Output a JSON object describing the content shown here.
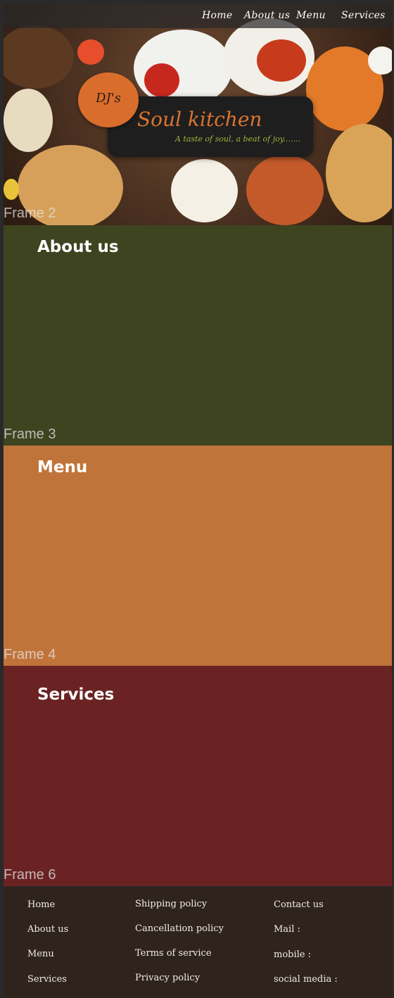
{
  "nav": {
    "items": [
      "Home",
      "About us",
      "Menu",
      "Services"
    ]
  },
  "brand": {
    "logo": "DJ's",
    "title": "Soul kitchen",
    "tagline": "A taste of soul, a beat of joy......."
  },
  "frames": {
    "hero_next_label": "Frame 2",
    "about_label": "Frame 3",
    "menu_label": "Frame 4",
    "services_label": "Frame 6"
  },
  "sections": {
    "about": {
      "title": "About us",
      "color": "#3e4420"
    },
    "menu": {
      "title": "Menu",
      "color": "#c0743a"
    },
    "services": {
      "title": "Services",
      "color": "#6a2222"
    }
  },
  "footer": {
    "col1": [
      "Home",
      "About us",
      "Menu",
      "Services"
    ],
    "col2": [
      "Shipping policy",
      "Cancellation policy",
      "Terms of service",
      "Privacy policy"
    ],
    "col3": [
      "Contact us",
      "Mail :",
      "mobile :",
      "social media :"
    ]
  },
  "colors": {
    "accent_orange": "#d9742f",
    "accent_green": "#9cb33c",
    "footer_bg": "#2e241d"
  }
}
